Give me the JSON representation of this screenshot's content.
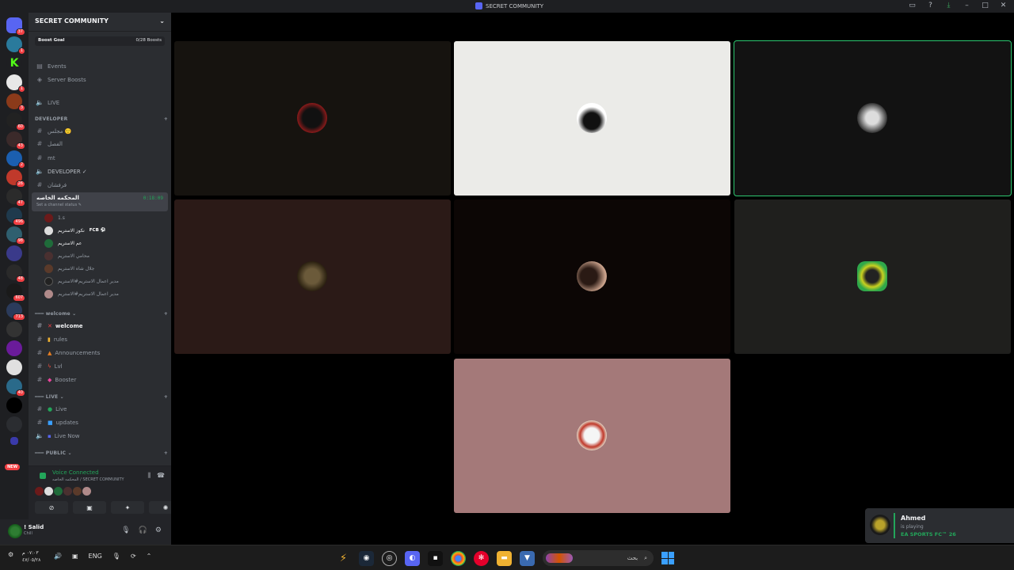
{
  "window": {
    "title": "SECRET COMMUNITY"
  },
  "rail": {
    "badges": [
      "37",
      "1",
      "1",
      "3",
      "60",
      "43",
      "2",
      "26",
      "47",
      "496",
      "98",
      "48",
      "607",
      "713",
      "40"
    ],
    "new_label": "NEW"
  },
  "sidebar": {
    "server_name": "SECRET COMMUNITY",
    "boost_goal_label": "Boost Goal",
    "boost_goal_value": "0/28 Boosts",
    "events": "Events",
    "server_boosts": "Server Boosts",
    "live_channel": "LIVE",
    "categories": {
      "developer": "DEVELOPER",
      "welcome": "welcome",
      "live": "LIVE",
      "public": "PUBLIC"
    },
    "dev_channels": [
      "مجلس 🙂",
      "الفصل",
      "mt",
      "DEVELOPER ✓",
      "فرفشان"
    ],
    "active_voice": {
      "name": "المحكمه الخاصه",
      "status": "Set a channel status ✎",
      "timer": "0:18:09"
    },
    "voice_members": [
      {
        "name": "1.s",
        "tag": ""
      },
      {
        "name": "نكوز الاستريم",
        "tag": "FCB ⚽"
      },
      {
        "name": "عم الاستريم",
        "tag": ""
      },
      {
        "name": "محامي الاستريم",
        "tag": ""
      },
      {
        "name": "جلال شاه الاستريم",
        "tag": ""
      },
      {
        "name": "مدير اعمال الاستريم#الاستريم",
        "tag": ""
      },
      {
        "name": "مدير اعمال الاستريم#الاستريم",
        "tag": ""
      }
    ],
    "welcome_channels": [
      "welcome",
      "rules",
      "Announcements",
      "Lvl",
      "Booster"
    ],
    "live_channels": [
      "Live",
      "updates",
      "Live Now"
    ]
  },
  "voice_panel": {
    "title": "Voice Connected",
    "subtitle": "المحكمه الخاصه / SECRET COMMUNITY"
  },
  "user_panel": {
    "name": "! Salid",
    "status": "Chill"
  },
  "notification": {
    "name": "Ahmed",
    "activity": "is playing",
    "game": "EA SPORTS FC™ 26"
  },
  "taskbar": {
    "time": "٠٧:٠٣ م",
    "date": "٤٧/٠٥/٢٨",
    "lang": "ENG",
    "search_placeholder": "بحث"
  },
  "colors": {
    "accent_green": "#23a55a",
    "speaking_outline": "#2dc770",
    "tile_colors": [
      "#16130f",
      "#ebebe8",
      "#121212",
      "#2b1a17",
      "#0c0605",
      "#1f1f1d",
      "#a47979"
    ]
  }
}
